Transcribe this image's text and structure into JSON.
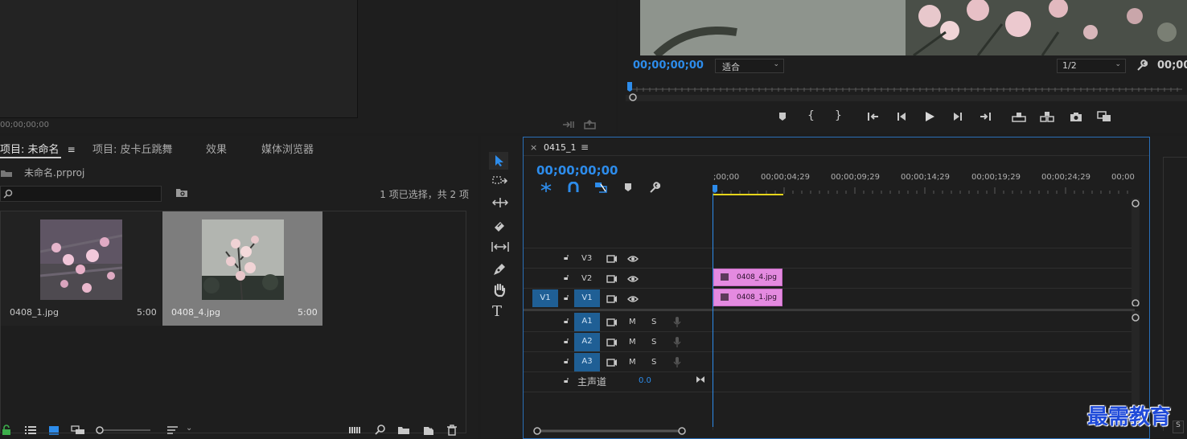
{
  "source_monitor": {
    "timecode": "00;00;00;00"
  },
  "program_monitor": {
    "timecode": "00;00;00;00",
    "fit": "适合",
    "resolution": "1/2",
    "timecode_right": "00;00"
  },
  "project_panel": {
    "tabs": [
      "项目: 未命名",
      "项目: 皮卡丘跳舞",
      "效果",
      "媒体浏览器"
    ],
    "project_file": "未命名.prproj",
    "search_placeholder": "",
    "selection_status": "1 项已选择，共 2 项",
    "items": [
      {
        "name": "0408_1.jpg",
        "duration": "5:00"
      },
      {
        "name": "0408_4.jpg",
        "duration": "5:00"
      }
    ]
  },
  "timeline": {
    "sequence_name": "0415_1",
    "timecode": "00;00;00;00",
    "ruler": [
      ";00;00",
      "00;00;04;29",
      "00;00;09;29",
      "00;00;14;29",
      "00;00;19;29",
      "00;00;24;29",
      "00;00"
    ],
    "video_tracks": [
      {
        "label": "V3"
      },
      {
        "label": "V2"
      },
      {
        "label": "V1",
        "source": "V1"
      }
    ],
    "audio_tracks": [
      {
        "label": "A1",
        "mute": "M",
        "solo": "S"
      },
      {
        "label": "A2",
        "mute": "M",
        "solo": "S"
      },
      {
        "label": "A3",
        "mute": "M",
        "solo": "S"
      }
    ],
    "master": {
      "label": "主声道",
      "value": "0.0"
    },
    "clips": [
      {
        "name": "0408_4.jpg",
        "track": "V2"
      },
      {
        "name": "0408_1.jpg",
        "track": "V1"
      }
    ]
  },
  "watermark": "最需教育",
  "colors": {
    "accent": "#2d8ceb",
    "clip": "#e48ae0",
    "track_active": "#1f5f95",
    "work_area": "#e5d51b"
  }
}
